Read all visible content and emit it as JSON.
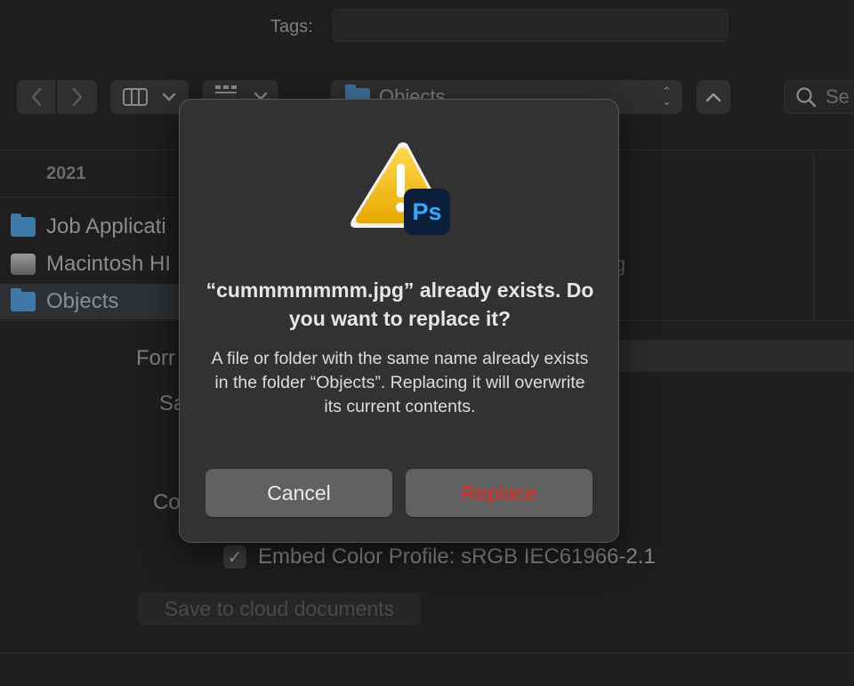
{
  "save_panel": {
    "tags_label": "Tags:",
    "tags_value": "",
    "location": "Objects",
    "search_placeholder": "Se",
    "sidebar": {
      "heading": "2021",
      "items": [
        {
          "label": "Job Applicati",
          "icon": "folder-icon",
          "selected": false
        },
        {
          "label": "Macintosh HI",
          "icon": "hard-disk-icon",
          "selected": false
        },
        {
          "label": "Objects",
          "icon": "folder-icon",
          "selected": true
        }
      ]
    },
    "file_list_fragment": "g",
    "format_label_fragment": "Forr",
    "save_label_fragment": "Sa",
    "color_label_fragment": "Co",
    "embed_color_profile": {
      "checked": true,
      "label": "Embed Color Profile:  sRGB IEC61966-2.1"
    },
    "cloud_button": "Save to cloud documents"
  },
  "dialog": {
    "title": "“cummmmmmm.jpg” already exists. Do you want to replace it?",
    "message": "A file or folder with the same name already exists in the folder “Objects”. Replacing it will overwrite its current contents.",
    "app_badge": "Ps",
    "cancel_label": "Cancel",
    "replace_label": "Replace"
  },
  "colors": {
    "dialog_bg": "#323232",
    "button_bg": "#616161",
    "destructive_text": "#e8271f",
    "warning_yellow": "#f5c400",
    "photoshop_badge_bg": "#0b1f3a",
    "photoshop_badge_text": "#31a8ff"
  }
}
